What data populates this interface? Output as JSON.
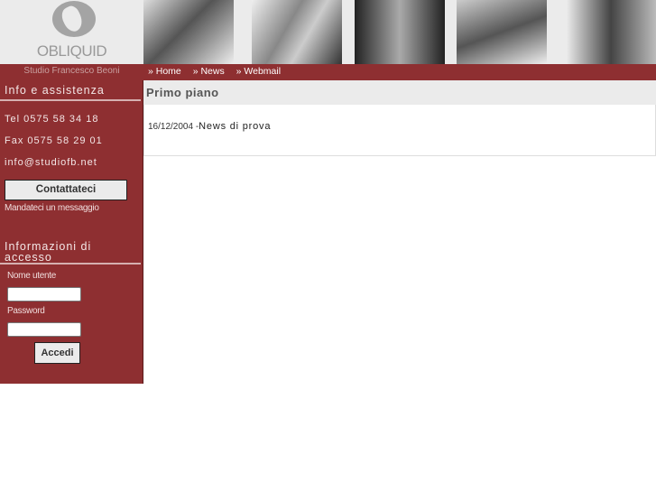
{
  "header": {
    "logo_text": "OBLIQUID",
    "studio": "Studio Francesco Beoni"
  },
  "nav": [
    {
      "label": "» Home"
    },
    {
      "label": "» News"
    },
    {
      "label": "» Webmail"
    }
  ],
  "sidebar": {
    "info_title": "Info e assistenza",
    "tel": "Tel 0575 58 34 18",
    "fax": "Fax 0575 58 29 01",
    "email": "info@studiofb.net",
    "contact_button": "Contattateci",
    "contact_sub": "Mandateci un messaggio",
    "login_title": "Informazioni di accesso",
    "username_label": "Nome utente",
    "password_label": "Password",
    "login_button": "Accedi"
  },
  "main": {
    "title": "Primo piano",
    "news": [
      {
        "date": "16/12/2004 -",
        "title": "News di prova"
      }
    ]
  }
}
